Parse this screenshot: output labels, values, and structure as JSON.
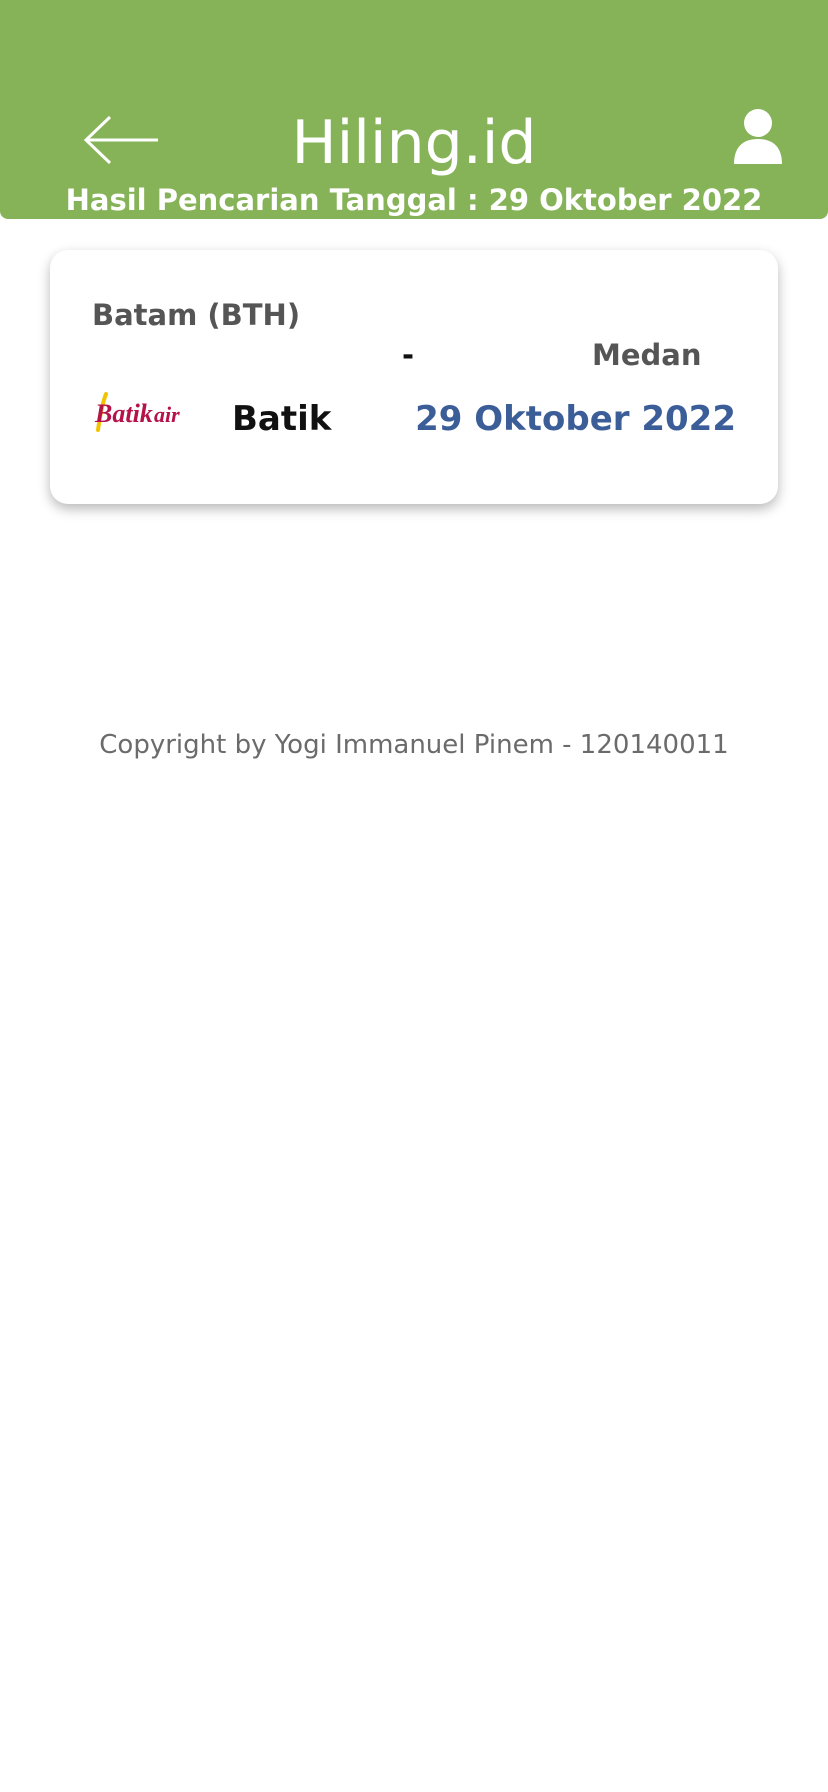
{
  "header": {
    "title": "Hiling.id",
    "subtitle": "Hasil Pencarian Tanggal : 29 Oktober 2022",
    "back_icon": "arrow-left-icon",
    "profile_icon": "user-icon",
    "background_color": "#86b358"
  },
  "results": [
    {
      "origin": "Batam (BTH)",
      "separator": "-",
      "destination": "Medan",
      "airline_name": "Batik",
      "airline_logo_text": "Batik air",
      "date": "29 Oktober 2022",
      "date_color": "#3b5e99"
    }
  ],
  "footer": {
    "copyright": "Copyright by Yogi Immanuel Pinem - 120140011"
  }
}
